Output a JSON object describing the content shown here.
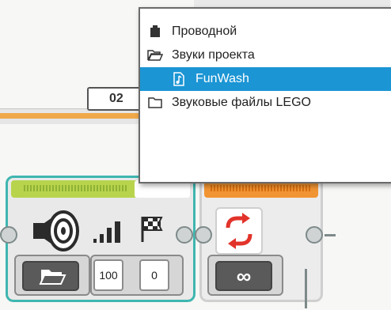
{
  "field": {
    "value": "02"
  },
  "popup": {
    "items": [
      {
        "label": "Проводной",
        "icon": "wired-icon"
      },
      {
        "label": "Звуки проекта",
        "icon": "folder-open-icon"
      },
      {
        "label": "FunWash",
        "icon": "music-file-icon",
        "selected": true
      },
      {
        "label": "Звуковые файлы LEGO",
        "icon": "folder-icon"
      }
    ]
  },
  "sound_block": {
    "volume": "100",
    "play_type": "0"
  },
  "loop_block": {
    "mode_symbol": "∞"
  },
  "colors": {
    "selection": "#1b95d4",
    "sound_block_accent": "#b8d44d",
    "loop_block_accent": "#f19433"
  }
}
